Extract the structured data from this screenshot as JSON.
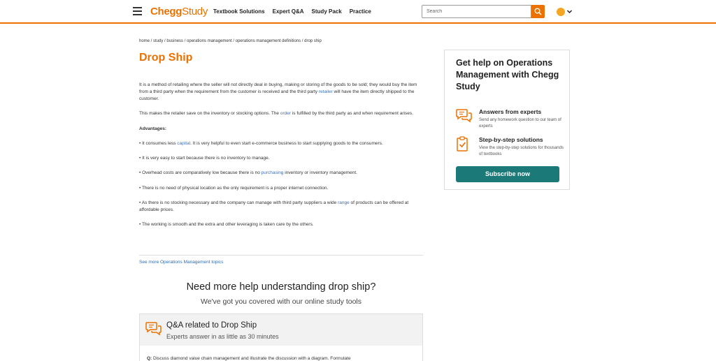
{
  "header": {
    "logo_brand": "Chegg",
    "logo_product": "Study",
    "nav": [
      "Textbook Solutions",
      "Expert Q&A",
      "Study Pack",
      "Practice"
    ],
    "search_placeholder": "Search",
    "accent_color": "#eb7100"
  },
  "breadcrumb": "home / study / business / operations management / operations management definitions / drop ship",
  "title": "Drop Ship",
  "content": {
    "p1_a": "It is a method of retailing where the seller will not directly deal in buying, making or storing of the goods to be sold; they would buy the item from a third party when the requirement from the customer is received and the third party ",
    "p1_link": "retailer",
    "p1_b": " will have the item directly shipped to the customer.",
    "p2_a": "This makes the retailer save on the inventory or stocking options. The ",
    "p2_link": "order",
    "p2_b": " is fulfilled by the third party as and when requirement arises.",
    "advantages_label": "Advantages:",
    "b1_a": "• It consumes less ",
    "b1_link": "capital",
    "b1_b": ". It is very helpful to even start e-commerce business to start supplying goods to the consumers.",
    "b2": "• It is very easy to start because there is no inventory to manage.",
    "b3_a": "• Overhead costs are comparatively low because there is no ",
    "b3_link": "purchasing",
    "b3_b": " inventory or inventory management.",
    "b4": "• There is no need of physical location as the only requirement is a proper internet connection.",
    "b5_a": "• As there is no stocking necessary and the company can manage with third party suppliers a wide ",
    "b5_link": "range",
    "b5_b": " of products can be offered at affordable prices.",
    "b6": "• The working is smooth and the extra and other leveraging is taken care by the others."
  },
  "see_more": "See more Operations Management topics",
  "need_help": "Need more help understanding drop ship?",
  "covered": "We've got you covered with our online study tools",
  "qa": {
    "title": "Q&A related to Drop Ship",
    "subtitle": "Experts answer in as little as 30 minutes",
    "q_label": "Q:",
    "q_text": " Discuss diamond value chain management and illustrate the discussion with a diagram. Formulate"
  },
  "sidebar": {
    "title": "Get help on Operations Management with Chegg Study",
    "features": [
      {
        "title": "Answers from experts",
        "desc": "Send any homework question to our team of experts",
        "icon": "chat-bubbles-icon"
      },
      {
        "title": "Step-by-step solutions",
        "desc": "View the step-by-step solutions for thousands of textbooks",
        "icon": "clipboard-check-icon"
      }
    ],
    "cta": "Subscribe now",
    "cta_color": "#1b7a77"
  }
}
